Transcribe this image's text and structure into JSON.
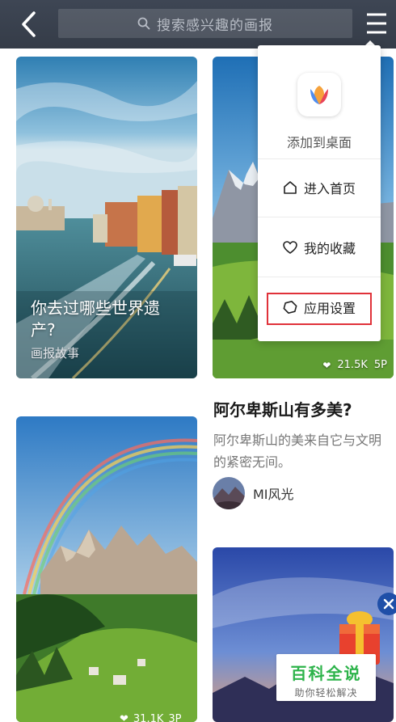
{
  "header": {
    "search_placeholder": "搜索感兴趣的画报"
  },
  "cards": [
    {
      "title": "你去过哪些世界遗产?",
      "subtitle": "画报故事"
    },
    {
      "likes": "21.5K",
      "pages": "5P"
    },
    {
      "likes": "31.1K",
      "pages": "3P"
    }
  ],
  "article": {
    "title": "阿尔卑斯山有多美?",
    "description": "阿尔卑斯山的美来自它与文明的紧密无间。",
    "author": "MI风光"
  },
  "popup_menu": {
    "add_to_desktop": "添加到桌面",
    "items": [
      {
        "label": "进入首页",
        "icon": "home-icon"
      },
      {
        "label": "我的收藏",
        "icon": "heart-icon"
      },
      {
        "label": "应用设置",
        "icon": "settings-hexagon-icon",
        "highlighted": true
      }
    ],
    "highlight_color": "#e0323a"
  },
  "watermark": {
    "title": "百科全说",
    "subtitle": "助你轻松解决"
  },
  "colors": {
    "header_bg": "#3a414d",
    "watermark_green": "#2db34a",
    "close_button": "#1f4fa8"
  }
}
